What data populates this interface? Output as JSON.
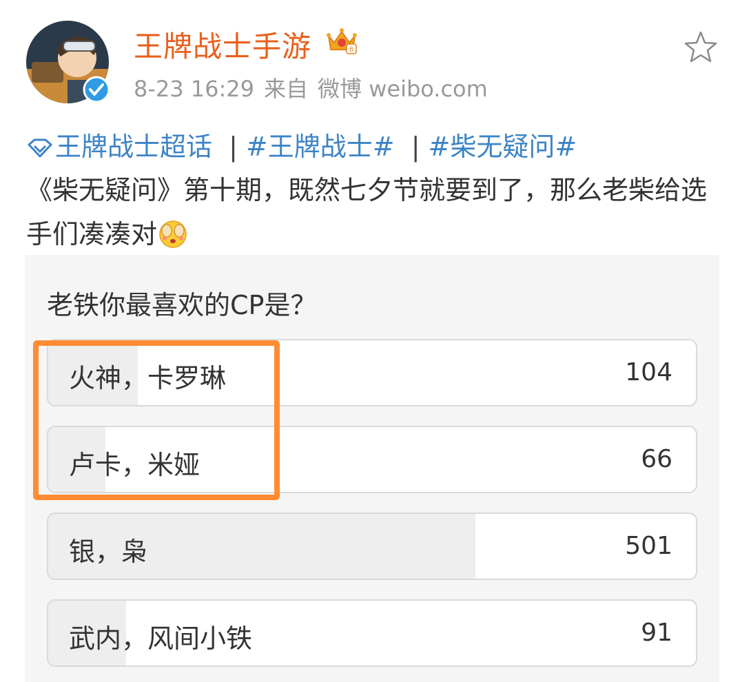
{
  "header": {
    "user_name": "王牌战士手游",
    "timestamp": "8-23 16:29",
    "source_prefix": "来自",
    "source": "微博 weibo.com",
    "favorite_icon": "star-outline-icon",
    "avatar_icon": "avatar",
    "verified_icon": "verified-badge-icon",
    "crown_icon": "crown-level-icon"
  },
  "post": {
    "topics": [
      {
        "label": "王牌战士超话"
      },
      {
        "label": "#王牌战士#"
      },
      {
        "label": "#柴无疑问#"
      }
    ],
    "separator": "|",
    "body": "《柴无疑问》第十期，既然七夕节就要到了，那么老柴给选手们凑凑对"
  },
  "poll": {
    "question": "老铁你最喜欢的CP是？",
    "options": [
      {
        "label": "火神，卡罗琳",
        "count": "104",
        "share": 0.138
      },
      {
        "label": "卢卡，米娅",
        "count": "66",
        "share": 0.088
      },
      {
        "label": "银，枭",
        "count": "501",
        "share": 0.66
      },
      {
        "label": "武内，风间小铁",
        "count": "91",
        "share": 0.12
      }
    ]
  },
  "colors": {
    "accent_name": "#e8601c",
    "topic_blue": "#3d84c6",
    "highlight_orange": "#ff8c33",
    "verified_blue": "#2f9be5"
  }
}
